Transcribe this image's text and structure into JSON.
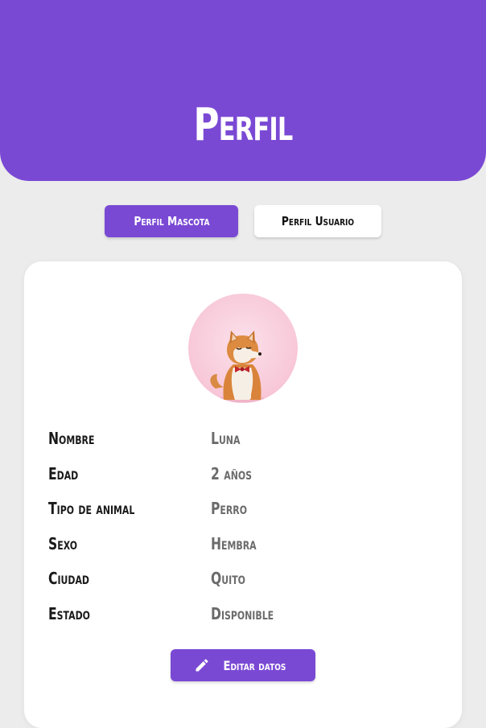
{
  "header": {
    "title": "Perfil"
  },
  "tabs": [
    {
      "label": "Perfil Mascota",
      "active": true
    },
    {
      "label": "Perfil Usuario",
      "active": false
    }
  ],
  "profile": {
    "rows": [
      {
        "label": "Nombre",
        "value": "Luna"
      },
      {
        "label": "Edad",
        "value": "2 años"
      },
      {
        "label": "Tipo de animal",
        "value": "Perro"
      },
      {
        "label": "Sexo",
        "value": "Hembra"
      },
      {
        "label": "Ciudad",
        "value": "Quito"
      },
      {
        "label": "Estado",
        "value": "Disponible"
      }
    ],
    "edit_label": "Editar datos"
  },
  "icons": {
    "edit": "pencil-icon",
    "avatar": "shiba-dog-photo"
  },
  "colors": {
    "brand": "#7a49d4",
    "background": "#ececec",
    "card": "#ffffff",
    "label_text": "#1a1a1a",
    "value_text": "#6b6b6b"
  }
}
